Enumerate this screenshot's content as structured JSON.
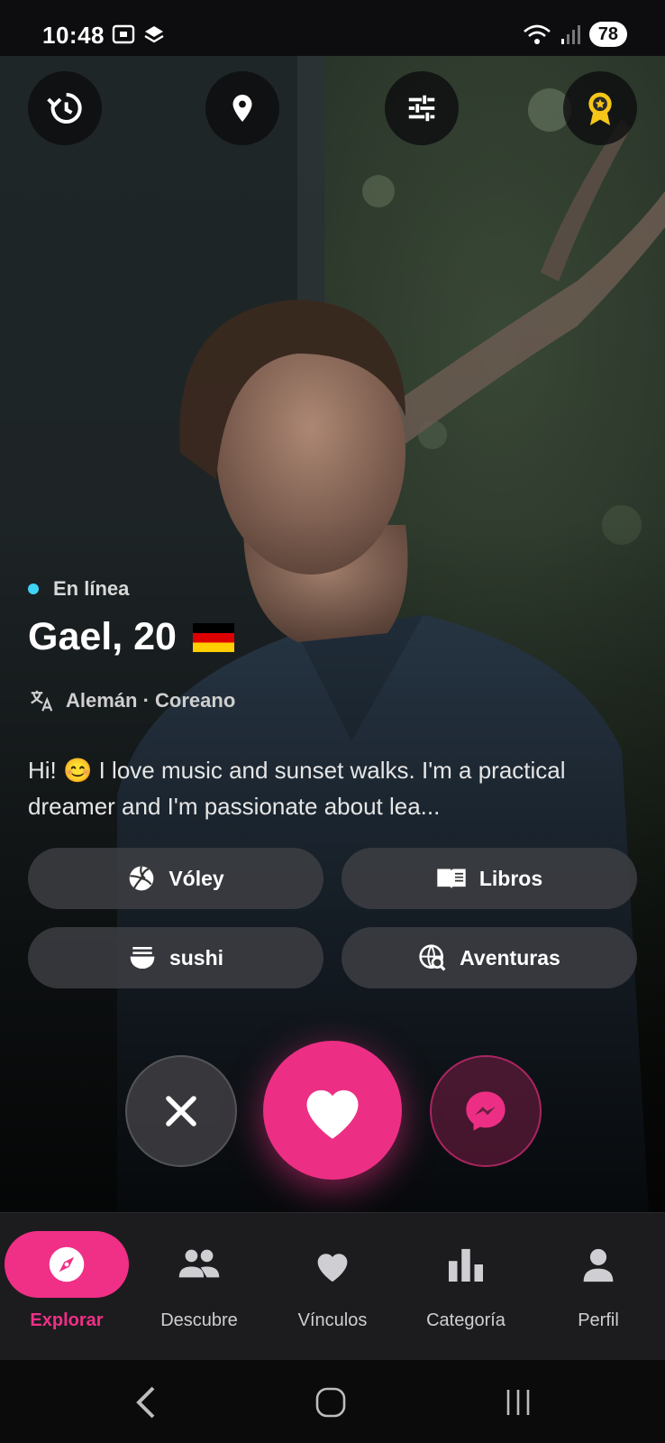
{
  "status_bar": {
    "time": "10:48",
    "battery": "78"
  },
  "profile": {
    "online_label": "En línea",
    "name_age": "Gael, 20",
    "flag": "🇩🇪",
    "languages": "Alemán · Coreano",
    "bio": "Hi! 😊 I love music and sunset walks. I'm a practical dreamer and I'm passionate about lea..."
  },
  "interests": [
    {
      "label": "Vóley",
      "icon": "volleyball-icon"
    },
    {
      "label": "Libros",
      "icon": "book-icon"
    },
    {
      "label": "sushi",
      "icon": "ramen-bowl-icon"
    },
    {
      "label": "Aventuras",
      "icon": "globe-search-icon"
    }
  ],
  "top_controls": [
    "history-icon",
    "location-pin-icon",
    "filter-sliders-icon",
    "premium-badge-icon"
  ],
  "nav": {
    "items": [
      {
        "label": "Explorar",
        "icon": "compass-icon",
        "active": true
      },
      {
        "label": "Descubre",
        "icon": "people-icon"
      },
      {
        "label": "Vínculos",
        "icon": "heart-icon"
      },
      {
        "label": "Categoría",
        "icon": "bar-chart-icon"
      },
      {
        "label": "Perfil",
        "icon": "person-icon"
      }
    ]
  },
  "colors": {
    "accent": "#f02f86",
    "online": "#3fd4f5",
    "gold": "#f5c518"
  }
}
